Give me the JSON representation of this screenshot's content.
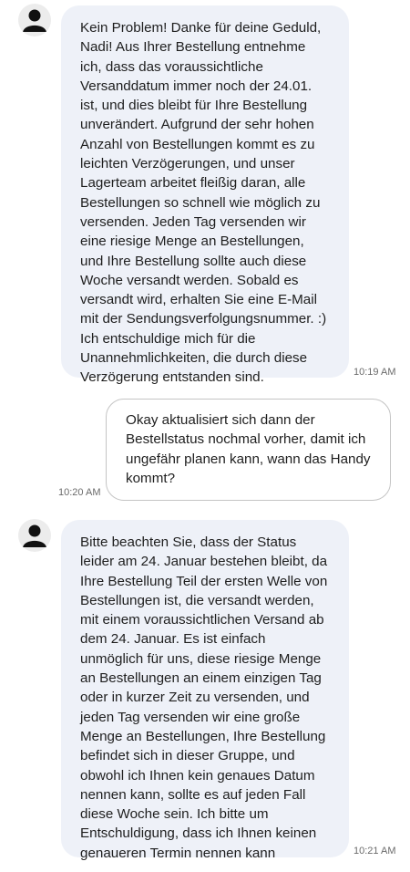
{
  "messages": [
    {
      "sender": "agent",
      "text": "Kein Problem! Danke für deine Geduld, Nadi! Aus Ihrer Bestellung entnehme ich, dass das voraussichtliche Versanddatum immer noch der 24.01. ist, und dies bleibt für Ihre Bestellung unverändert. Aufgrund der sehr hohen Anzahl von Bestellungen kommt es zu leichten Verzögerungen, und unser Lagerteam arbeitet fleißig daran, alle Bestellungen so schnell wie möglich zu versenden. Jeden Tag versenden wir eine riesige Menge an Bestellungen, und Ihre Bestellung sollte auch diese Woche versandt werden. Sobald es versandt wird, erhalten Sie eine E-Mail mit der Sendungsverfolgungsnummer. :) Ich entschuldige mich für die Unannehmlichkeiten, die durch diese Verzögerung entstanden sind.",
      "time": "10:19 AM"
    },
    {
      "sender": "user",
      "text": "Okay aktualisiert sich dann der Bestellstatus nochmal vorher, damit ich ungefähr planen kann, wann das Handy kommt?",
      "time": "10:20 AM"
    },
    {
      "sender": "agent",
      "text": "Bitte beachten Sie, dass der Status leider am 24. Januar bestehen bleibt, da Ihre Bestellung Teil der ersten Welle von Bestellungen ist, die versandt werden, mit einem voraussichtlichen Versand ab dem 24. Januar. Es ist einfach unmöglich für uns, diese riesige Menge an Bestellungen an einem einzigen Tag oder in kurzer Zeit zu versenden, und jeden Tag versenden wir eine große Menge an Bestellungen, Ihre Bestellung befindet sich in dieser Gruppe, und obwohl ich Ihnen kein genaues Datum nennen kann, sollte es auf jeden Fall diese Woche sein. Ich bitte um Entschuldigung, dass ich Ihnen keinen genaueren Termin nennen kann",
      "time": "10:21 AM"
    }
  ],
  "icons": {
    "avatar": "person-avatar-icon"
  }
}
